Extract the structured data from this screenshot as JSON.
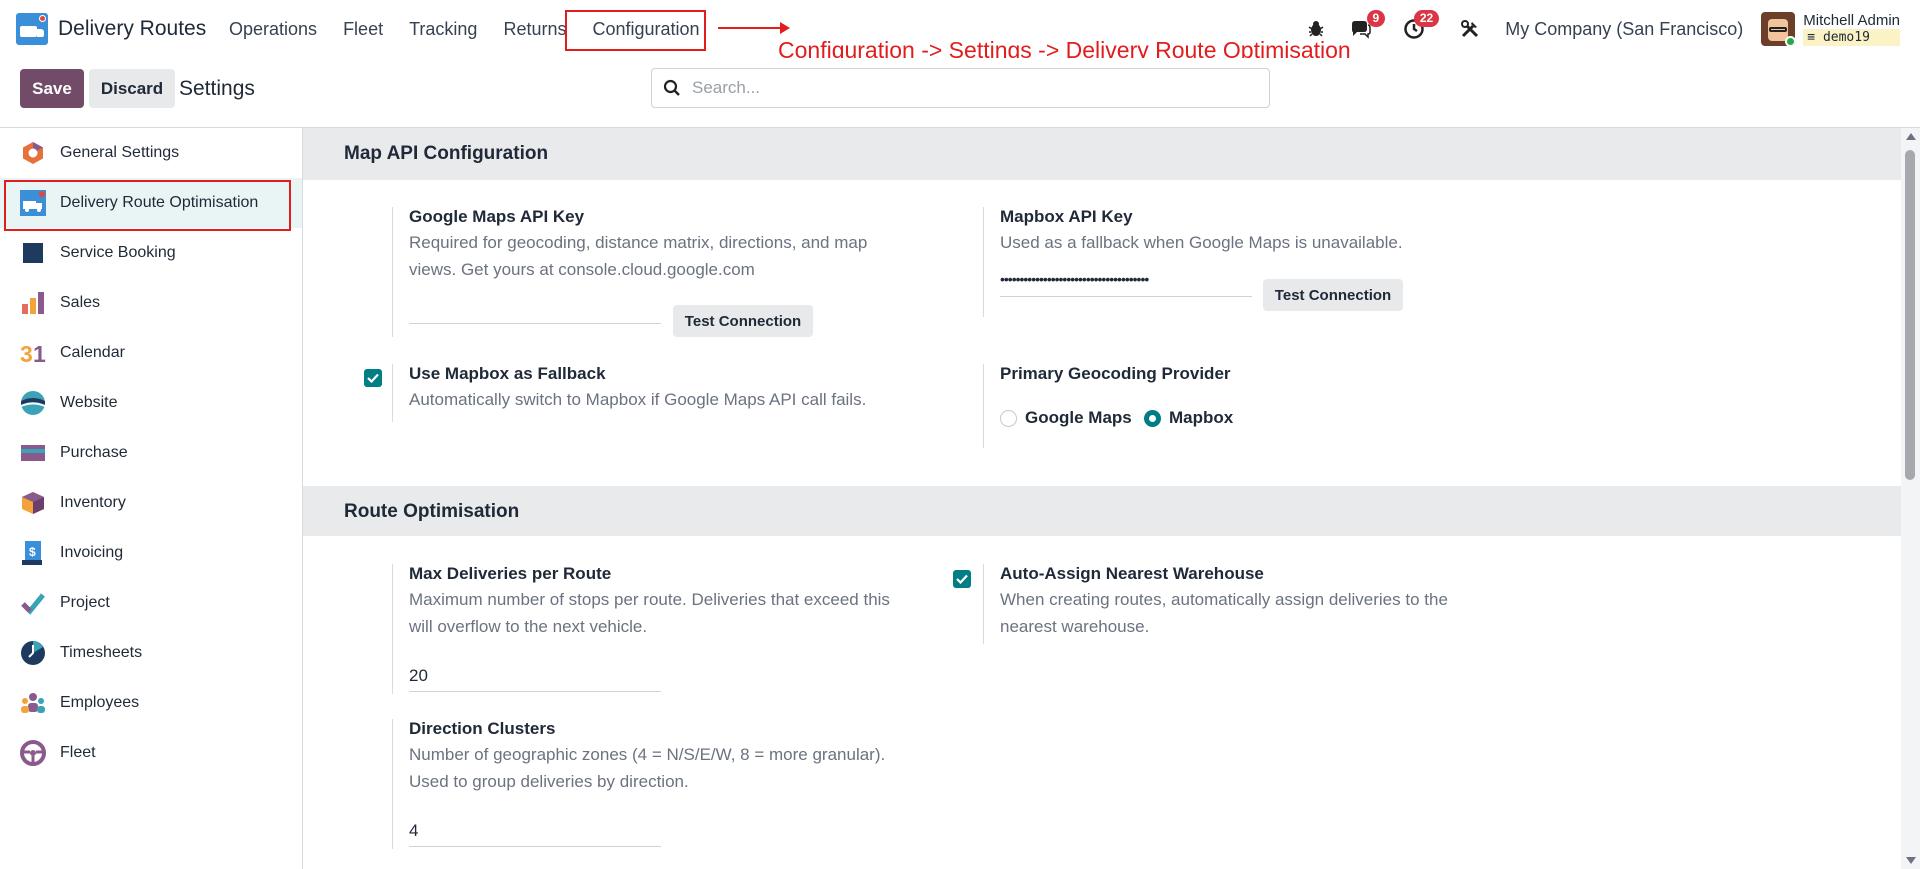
{
  "app": {
    "name": "Delivery Routes",
    "logo_icon": "delivery-truck-icon"
  },
  "menu": [
    {
      "label": "Operations"
    },
    {
      "label": "Fleet"
    },
    {
      "label": "Tracking"
    },
    {
      "label": "Returns"
    },
    {
      "label": "Configuration"
    }
  ],
  "annotation": {
    "text": "Configuration -> Settings -> Delivery Route Optimisation",
    "color": "#e11d1d"
  },
  "systray": {
    "debug_icon": "bug-icon",
    "messages_count": "9",
    "activities_count": "22",
    "company": "My Company (San Francisco)",
    "user_name": "Mitchell Admin",
    "database": "demo19"
  },
  "control": {
    "save_label": "Save",
    "discard_label": "Discard",
    "breadcrumb": "Settings",
    "search_placeholder": "Search..."
  },
  "sidebar": {
    "items": [
      {
        "label": "General Settings",
        "icon": "hexagon-logo-icon"
      },
      {
        "label": "Delivery Route Optimisation",
        "icon": "delivery-truck-icon"
      },
      {
        "label": "Service Booking",
        "icon": "square-icon"
      },
      {
        "label": "Sales",
        "icon": "bar-chart-icon"
      },
      {
        "label": "Calendar",
        "icon": "calendar-icon"
      },
      {
        "label": "Website",
        "icon": "globe-icon"
      },
      {
        "label": "Purchase",
        "icon": "card-icon"
      },
      {
        "label": "Inventory",
        "icon": "box-icon"
      },
      {
        "label": "Invoicing",
        "icon": "invoice-icon"
      },
      {
        "label": "Project",
        "icon": "check-icon"
      },
      {
        "label": "Timesheets",
        "icon": "clock-icon"
      },
      {
        "label": "Employees",
        "icon": "people-icon"
      },
      {
        "label": "Fleet",
        "icon": "steering-wheel-icon"
      }
    ]
  },
  "map_api": {
    "title": "Map API Configuration",
    "google": {
      "title": "Google Maps API Key",
      "desc": "Required for geocoding, distance matrix, directions, and map views. Get yours at console.cloud.google.com",
      "value": "",
      "button": "Test Connection"
    },
    "mapbox": {
      "title": "Mapbox API Key",
      "desc": "Used as a fallback when Google Maps is unavailable.",
      "value": "••••••••••••••••••••••••••••••••••••••",
      "button": "Test Connection"
    },
    "fallback": {
      "title": "Use Mapbox as Fallback",
      "desc": "Automatically switch to Mapbox if Google Maps API call fails.",
      "checked": true
    },
    "provider": {
      "title": "Primary Geocoding Provider",
      "options": [
        "Google Maps",
        "Mapbox"
      ],
      "selected": "Mapbox"
    }
  },
  "route_opt": {
    "title": "Route Optimisation",
    "max_deliveries": {
      "title": "Max Deliveries per Route",
      "desc": "Maximum number of stops per route. Deliveries that exceed this will overflow to the next vehicle.",
      "value": "20"
    },
    "auto_assign": {
      "title": "Auto-Assign Nearest Warehouse",
      "desc": "When creating routes, automatically assign deliveries to the nearest warehouse.",
      "checked": true
    },
    "clusters": {
      "title": "Direction Clusters",
      "desc": "Number of geographic zones (4 = N/S/E/W, 8 = more granular). Used to group deliveries by direction.",
      "value": "4"
    }
  },
  "colors": {
    "primary": "#714b67",
    "accent": "#017e84",
    "annotation": "#e11d1d"
  }
}
